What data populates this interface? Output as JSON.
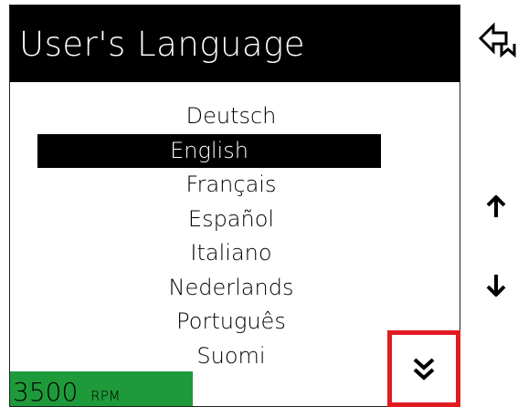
{
  "screen": {
    "title": "User's Language",
    "languages": [
      {
        "label": "Deutsch",
        "selected": false
      },
      {
        "label": "English",
        "selected": true
      },
      {
        "label": "Français",
        "selected": false
      },
      {
        "label": "Español",
        "selected": false
      },
      {
        "label": "Italiano",
        "selected": false
      },
      {
        "label": "Nederlands",
        "selected": false
      },
      {
        "label": "Português",
        "selected": false
      },
      {
        "label": "Suomi",
        "selected": false
      }
    ],
    "status": {
      "rpm_value": "3500",
      "rpm_unit": "RPM",
      "status_color": "#1f9a3a"
    }
  },
  "side_buttons": {
    "back_icon": "back-arrow-icon",
    "up_icon": "arrow-up-icon",
    "down_icon": "arrow-down-icon",
    "page_down_icon": "double-chevron-down-icon",
    "highlight_color": "#e11b22"
  }
}
